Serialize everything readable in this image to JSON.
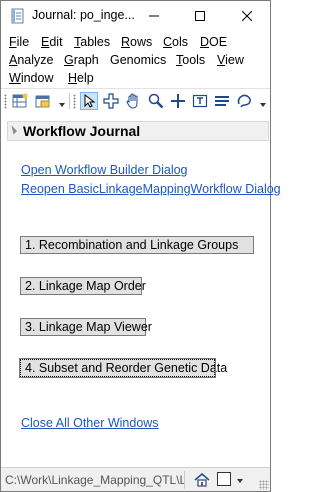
{
  "window": {
    "title": "Journal: po_inge..."
  },
  "menu": {
    "row1": [
      {
        "label": "File",
        "u": "F",
        "rest": "ile"
      },
      {
        "label": "Edit",
        "u": "E",
        "rest": "dit"
      },
      {
        "label": "Tables",
        "u": "T",
        "rest": "ables"
      },
      {
        "label": "Rows",
        "u": "R",
        "rest": "ows"
      },
      {
        "label": "Cols",
        "u": "C",
        "rest": "ols"
      },
      {
        "label": "DOE",
        "u": "D",
        "rest": "OE"
      }
    ],
    "row2": [
      {
        "label": "Analyze",
        "u": "A",
        "rest": "nalyze"
      },
      {
        "label": "Graph",
        "u": "G",
        "rest": "raph"
      },
      {
        "label": "Genomics",
        "u": "",
        "rest": "Genomics"
      },
      {
        "label": "Tools",
        "u": "T",
        "rest": "ools"
      },
      {
        "label": "View",
        "u": "V",
        "rest": "iew"
      }
    ],
    "row3": [
      {
        "label": "Window",
        "u": "W",
        "rest": "indow"
      },
      {
        "label": "Help",
        "u": "H",
        "rest": "elp"
      }
    ]
  },
  "toolbar": {
    "icons": [
      "new-data-table-icon",
      "open-icon",
      "arrow-tool-icon",
      "crosshair-tool-icon",
      "hand-tool-icon",
      "magnifier-tool-icon",
      "plus-tool-icon",
      "text-annotation-icon",
      "line-tool-icon",
      "lasso-tool-icon"
    ],
    "active_tool": "arrow-tool-icon"
  },
  "journal": {
    "outline_title": "Workflow Journal",
    "links": {
      "open_builder": "Open Workflow Builder Dialog",
      "reopen": "Reopen BasicLinkageMappingWorkflow Dialog",
      "close_all": "Close All Other Windows"
    },
    "buttons": {
      "b1": "1. Recombination and Linkage Groups",
      "b2": "2. Linkage Map Order",
      "b3": "3. Linkage Map Viewer",
      "b4": "4. Subset and Reorder Genetic Data"
    }
  },
  "status": {
    "path": "C:\\Work\\Linkage_Mapping_QTL\\L"
  },
  "colors": {
    "link": "#1f56c4",
    "button_face": "#e1e1e1",
    "header_bg": "#f0f0f0"
  }
}
